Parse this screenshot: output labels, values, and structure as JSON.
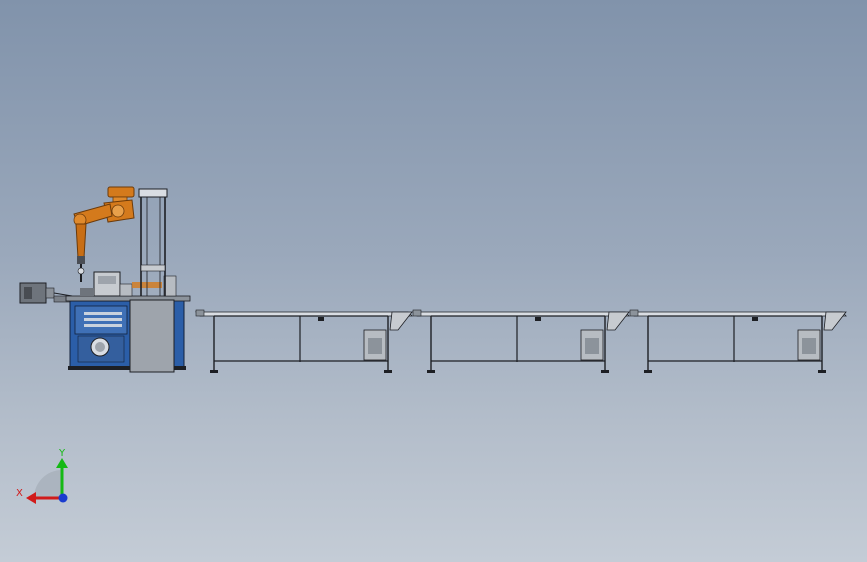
{
  "triad": {
    "x_label": "X",
    "y_label": "Y",
    "x_color": "#d11a1a",
    "y_color": "#15b915",
    "z_color": "#1a3ccf"
  },
  "colors": {
    "background_top": "#8193ab",
    "background_bottom": "#c4ccd6",
    "machine_base": "#2b5ea8",
    "robot_orange": "#d47a1c",
    "frame_line": "#1d1f24",
    "column_gray": "#9ea4ac"
  },
  "icons": [
    "coordinate-triad-icon"
  ]
}
